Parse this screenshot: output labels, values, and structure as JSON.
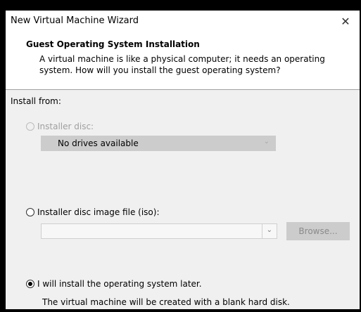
{
  "window": {
    "title": "New Virtual Machine Wizard",
    "close_symbol": "✕"
  },
  "header": {
    "title": "Guest Operating System Installation",
    "description": "A virtual machine is like a physical computer; it needs an operating system. How will you install the guest operating system?"
  },
  "content": {
    "install_from_label": "Install from:",
    "options": [
      {
        "label": "Installer disc:",
        "selected": false,
        "enabled": false
      },
      {
        "label": "Installer disc image file (iso):",
        "selected": false,
        "enabled": true
      },
      {
        "label": "I will install the operating system later.",
        "selected": true,
        "enabled": true
      }
    ],
    "drive_select": {
      "value": "No drives available",
      "enabled": false
    },
    "iso_select": {
      "value": ""
    },
    "browse_label": "Browse...",
    "later_note": "The virtual machine will be created with a blank hard disk."
  },
  "icons": [
    "close-icon",
    "chevron-down-icon",
    "radio-icon"
  ],
  "colors": {
    "content_bg": "#f0f0f0",
    "disabled_control": "#cccccc",
    "disabled_text": "#9f9f9f"
  }
}
